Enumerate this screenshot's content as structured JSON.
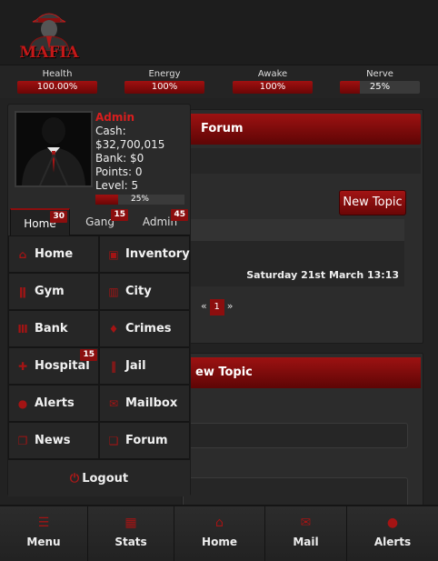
{
  "logo": {
    "text": "MAFIA"
  },
  "stats": [
    {
      "label": "Health",
      "value": "100.00%",
      "fill": 1.0
    },
    {
      "label": "Energy",
      "value": "100%",
      "fill": 1.0
    },
    {
      "label": "Awake",
      "value": "100%",
      "fill": 1.0
    },
    {
      "label": "Nerve",
      "value": "25%",
      "fill": 0.25
    }
  ],
  "forum": {
    "header": "Forum",
    "new_topic_button": "New Topic",
    "last_post_date": "Saturday 21st March 13:13",
    "pager": {
      "prev": "«",
      "current": "1",
      "next": "»"
    }
  },
  "new_topic_panel": {
    "header": "ew Topic"
  },
  "profile": {
    "name": "Admin",
    "cash": "Cash: $32,700,015",
    "bank": "Bank: $0",
    "points": "Points: 0",
    "level": "Level: 5",
    "xp_value": "25%",
    "xp_fill": 0.25
  },
  "tabs": [
    {
      "label": "Home",
      "badge": "30"
    },
    {
      "label": "Gang",
      "badge": "15"
    },
    {
      "label": "Admin",
      "badge": "45"
    }
  ],
  "menu": [
    {
      "label": "Home",
      "icon": "home-icon"
    },
    {
      "label": "Inventory",
      "icon": "inventory-icon"
    },
    {
      "label": "Gym",
      "icon": "gym-icon"
    },
    {
      "label": "City",
      "icon": "city-icon"
    },
    {
      "label": "Bank",
      "icon": "bank-icon"
    },
    {
      "label": "Crimes",
      "icon": "crimes-icon"
    },
    {
      "label": "Hospital",
      "icon": "hospital-icon",
      "badge": "15"
    },
    {
      "label": "Jail",
      "icon": "jail-icon"
    },
    {
      "label": "Alerts",
      "icon": "alerts-icon"
    },
    {
      "label": "Mailbox",
      "icon": "mailbox-icon"
    },
    {
      "label": "News",
      "icon": "news-icon"
    },
    {
      "label": "Forum",
      "icon": "forum-icon"
    }
  ],
  "logout": {
    "label": "Logout"
  },
  "bottom_nav": [
    {
      "label": "Menu",
      "icon": "menu-icon"
    },
    {
      "label": "Stats",
      "icon": "stats-icon"
    },
    {
      "label": "Home",
      "icon": "home-icon"
    },
    {
      "label": "Mail",
      "icon": "mail-icon"
    },
    {
      "label": "Alerts",
      "icon": "alerts-icon"
    }
  ],
  "colors": {
    "accent": "#8b0e0e",
    "name": "#d81e1e",
    "background": "#222222"
  }
}
